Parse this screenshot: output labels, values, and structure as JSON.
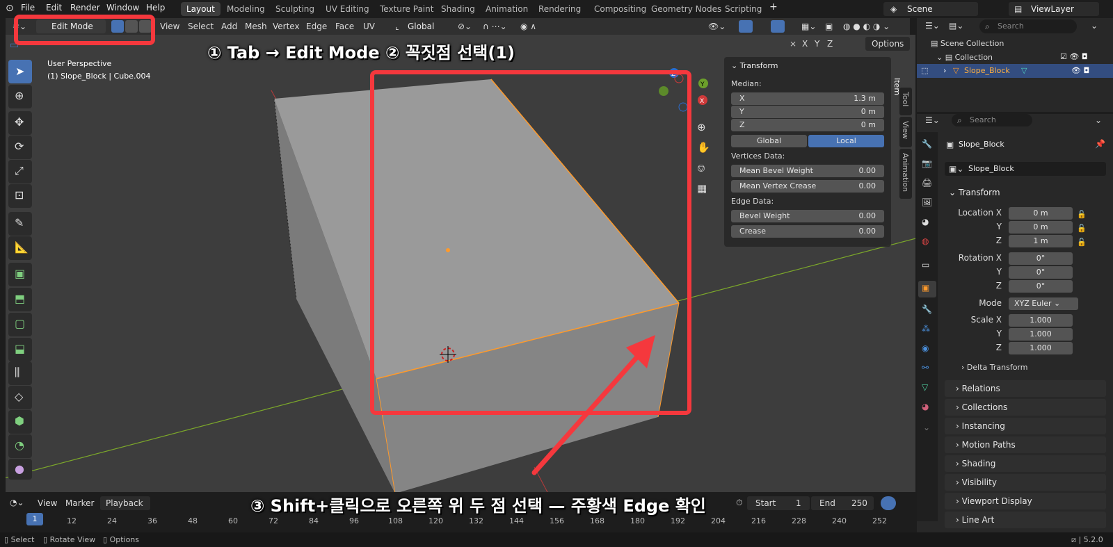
{
  "menu": [
    "File",
    "Edit",
    "Render",
    "Window",
    "Help"
  ],
  "workspaces": [
    "Layout",
    "Modeling",
    "Sculpting",
    "UV Editing",
    "Texture Paint",
    "Shading",
    "Animation",
    "Rendering",
    "Compositing",
    "Geometry Nodes",
    "Scripting"
  ],
  "active_workspace": "Layout",
  "scene": "Scene",
  "view_layer": "ViewLayer",
  "header": {
    "mode": "Edit Mode",
    "menus": [
      "View",
      "Select",
      "Add",
      "Mesh",
      "Vertex",
      "Edge",
      "Face",
      "UV"
    ],
    "orientation": "Global",
    "options": "Options",
    "axes": [
      "X",
      "Y",
      "Z"
    ]
  },
  "viewport": {
    "perspective": "User Perspective",
    "object_info": "(1) Slope_Block | Cube.004"
  },
  "side_tabs": [
    "Item",
    "Tool",
    "View",
    "Animation"
  ],
  "transform_panel": {
    "title": "Transform",
    "median_label": "Median:",
    "x_label": "X",
    "x_value": "1.3 m",
    "y_label": "Y",
    "y_value": "0 m",
    "z_label": "Z",
    "z_value": "0 m",
    "global_label": "Global",
    "local_label": "Local",
    "vertices_data": "Vertices Data:",
    "mean_bevel_weight": "Mean Bevel Weight",
    "mean_bevel_weight_value": "0.00",
    "mean_vertex_crease": "Mean Vertex Crease",
    "mean_vertex_crease_value": "0.00",
    "edge_data": "Edge Data:",
    "bevel_weight": "Bevel Weight",
    "bevel_weight_value": "0.00",
    "crease": "Crease",
    "crease_value": "0.00"
  },
  "outliner": {
    "search_placeholder": "Search",
    "scene_collection": "Scene Collection",
    "collection": "Collection",
    "object": "Slope_Block"
  },
  "properties": {
    "search_placeholder": "Search",
    "object_name": "Slope_Block",
    "data_name": "Slope_Block",
    "transform": "Transform",
    "location_x": "Location X",
    "loc_x": "0 m",
    "y": "Y",
    "loc_y": "0 m",
    "z": "Z",
    "loc_z": "1 m",
    "rotation_x": "Rotation X",
    "rot_x": "0°",
    "rot_y": "0°",
    "rot_z": "0°",
    "mode_label": "Mode",
    "mode_value": "XYZ Euler",
    "scale_x": "Scale X",
    "scl_x": "1.000",
    "scl_y": "1.000",
    "scl_z": "1.000",
    "delta_transform": "Delta Transform",
    "sections": [
      "Relations",
      "Collections",
      "Instancing",
      "Motion Paths",
      "Shading",
      "Visibility",
      "Viewport Display",
      "Line Art"
    ]
  },
  "timeline": {
    "view": "View",
    "marker": "Marker",
    "playback": "Playback",
    "start_label": "Start",
    "start": "1",
    "end_label": "End",
    "end": "250",
    "current_frame": "1",
    "ticks": [
      "12",
      "24",
      "36",
      "48",
      "60",
      "72",
      "84",
      "96",
      "108",
      "120",
      "132",
      "144",
      "156",
      "168",
      "180",
      "192",
      "204",
      "216",
      "228",
      "240",
      "252"
    ]
  },
  "status": {
    "select": "Select",
    "rotate_view": "Rotate View",
    "options": "Options",
    "version": "5.2.0"
  },
  "annotations": {
    "step1": "① Tab → Edit Mode  ② 꼭짓점 선택(1)",
    "step3": "③ Shift+클릭으로 오른쪽 위 두 점 선택 — 주황색 Edge 확인"
  },
  "colors": {
    "accent": "#4772b3",
    "selection": "#ff9a2b",
    "annotation_red": "#f5383d"
  }
}
